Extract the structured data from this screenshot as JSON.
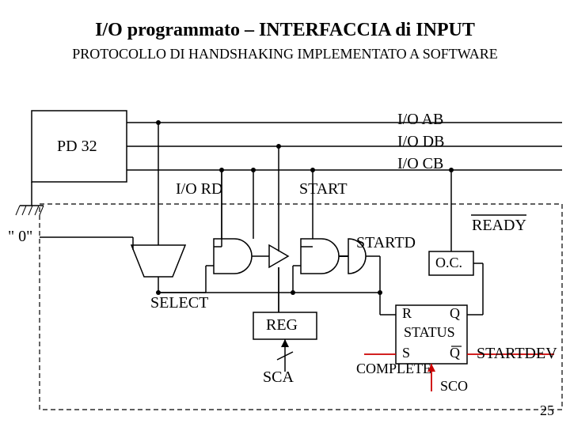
{
  "title": "I/O programmato – INTERFACCIA di INPUT",
  "subtitle": "PROTOCOLLO DI HANDSHAKING IMPLEMENTATO A SOFTWARE",
  "blocks": {
    "pd32": "PD 32",
    "zero": "\" 0\"",
    "io_rd": "I/O RD",
    "start": "START",
    "io_ab": "I/O AB",
    "io_db": "I/O DB",
    "io_cb": "I/O CB",
    "ready": "READY",
    "startd": "STARTD",
    "oc": "O.C.",
    "select": "SELECT",
    "reg": "REG",
    "sca": "SCA",
    "r": "R",
    "q": "Q",
    "status": "STATUS",
    "s": "S",
    "qbar": "Q",
    "complete": "COMPLETE",
    "startdev": "STARTDEV",
    "sco": "SCO"
  },
  "page": "25"
}
